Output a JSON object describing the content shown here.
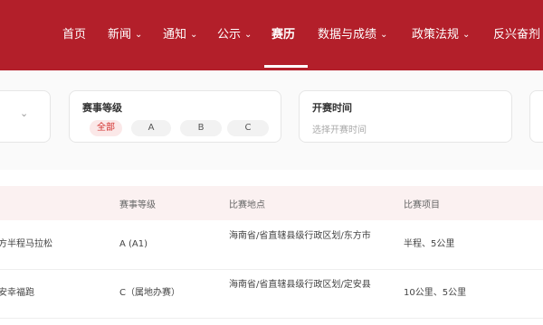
{
  "header": {
    "nav": [
      {
        "label": "首页"
      },
      {
        "label": "新闻",
        "dropdown": true
      },
      {
        "label": "通知",
        "dropdown": true
      },
      {
        "label": "公示",
        "dropdown": true
      },
      {
        "label": "赛历",
        "active": true
      },
      {
        "label": "数据与成绩",
        "dropdown": true
      },
      {
        "label": "政策法规",
        "dropdown": true
      },
      {
        "label": "反兴奋剂"
      }
    ]
  },
  "filters": {
    "level": {
      "title": "赛事等级",
      "options": [
        "全部",
        "A",
        "B",
        "C"
      ],
      "selected": "全部"
    },
    "date": {
      "title": "开赛时间",
      "placeholder": "选择开赛时间"
    }
  },
  "table": {
    "columns": [
      "赛事等级",
      "比赛地点",
      "比赛项目"
    ],
    "rows": [
      {
        "name": "方半程马拉松",
        "level": "A (A1)",
        "place": "海南省/省直辖县级行政区划/东方市",
        "items": "半程、5公里"
      },
      {
        "name": "安幸福跑",
        "level": "C（属地办赛）",
        "place": "海南省/省直辖县级行政区划/定安县",
        "items": "10公里、5公里"
      }
    ]
  },
  "colors": {
    "brand_red": "#b31f2a",
    "chip_active_text": "#d2302e"
  }
}
